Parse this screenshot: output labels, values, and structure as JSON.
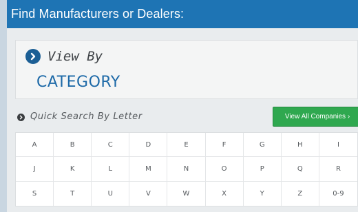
{
  "header": {
    "title": "Find Manufacturers or Dealers:"
  },
  "view": {
    "label": "View By",
    "category": "CATEGORY"
  },
  "quick_search": {
    "label": "Quick Search By Letter",
    "view_all": "View All Companies ›"
  },
  "letters": [
    "A",
    "B",
    "C",
    "D",
    "E",
    "F",
    "G",
    "H",
    "I",
    "J",
    "K",
    "L",
    "M",
    "N",
    "O",
    "P",
    "Q",
    "R",
    "S",
    "T",
    "U",
    "V",
    "W",
    "X",
    "Y",
    "Z",
    "0-9"
  ],
  "colors": {
    "header_bg": "#1e74b4",
    "accent": "#1e6aa8",
    "button_green": "#2fa84f"
  },
  "icons": {
    "view_by": "chevron-right-circle-icon",
    "quick_search": "chevron-right-circle-icon"
  }
}
